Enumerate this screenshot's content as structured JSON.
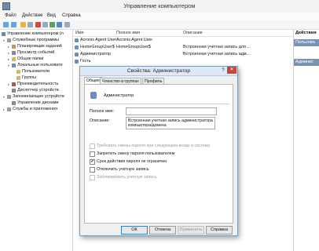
{
  "window": {
    "title": "Управление компьютером"
  },
  "menu": [
    "Файл",
    "Действие",
    "Вид",
    "Справка"
  ],
  "tree": {
    "root": "Управление компьютером (л",
    "items": [
      {
        "label": "Служебные программы",
        "level": 1,
        "expander": "▾"
      },
      {
        "label": "Планировщик заданий",
        "level": 2,
        "expander": "▸"
      },
      {
        "label": "Просмотр событий",
        "level": 2,
        "expander": "▸"
      },
      {
        "label": "Общие папки",
        "level": 2,
        "expander": "▸"
      },
      {
        "label": "Локальные пользовате",
        "level": 2,
        "expander": "▾"
      },
      {
        "label": "Пользователи",
        "level": 3,
        "expander": ""
      },
      {
        "label": "Группы",
        "level": 3,
        "expander": ""
      },
      {
        "label": "Производительность",
        "level": 2,
        "expander": "▸"
      },
      {
        "label": "Диспетчер устройств",
        "level": 2,
        "expander": ""
      },
      {
        "label": "Запоминающие устройств",
        "level": 1,
        "expander": "▾"
      },
      {
        "label": "Управление дисками",
        "level": 2,
        "expander": ""
      },
      {
        "label": "Службы и приложения",
        "level": 1,
        "expander": "▸"
      }
    ]
  },
  "list": {
    "headers": [
      "Имя",
      "Полное имя",
      "Описание"
    ],
    "rows": [
      {
        "name": "Acronis Agent User",
        "full_name": "Acronis Agent User",
        "description": ""
      },
      {
        "name": "HomeGroupUser$",
        "full_name": "HomeGroupUser$",
        "description": "Встроенная учетная запись для ..."
      },
      {
        "name": "Администратор",
        "full_name": "",
        "description": "Встроенная учетная запись адм..."
      },
      {
        "name": "Гость",
        "full_name": "",
        "description": ""
      }
    ]
  },
  "actions": {
    "header": "Действия",
    "bar1": "Пользова",
    "bar2": "Админис"
  },
  "dialog": {
    "title": "Свойства: Администратор",
    "help_glyph": "?",
    "close_glyph": "✕",
    "tabs": [
      "Общие",
      "Членство в группах",
      "Профиль"
    ],
    "user_name": "Администратор",
    "full_name_label": "Полное имя:",
    "full_name_value": "",
    "description_label": "Описание:",
    "description_value": "Встроенная учетная запись администратора компьютера/домена",
    "checkboxes": [
      {
        "label": "Требовать смены пароля при следующем входе в систему",
        "checked": false,
        "enabled": false
      },
      {
        "label": "Запретить смену пароля пользователем",
        "checked": false,
        "enabled": true
      },
      {
        "label": "Срок действия пароля не ограничен",
        "checked": true,
        "enabled": true
      },
      {
        "label": "Отключить учетную запись",
        "checked": false,
        "enabled": true
      },
      {
        "label": "Заблокировать учетную запись",
        "checked": false,
        "enabled": false
      }
    ],
    "buttons": {
      "ok": "ОК",
      "cancel": "Отмена",
      "apply": "Применить",
      "help": "Справка"
    }
  },
  "colors": {
    "accent": "#7a93b5",
    "close": "#c9472f",
    "dialog_bg": "#f0f0f0"
  }
}
